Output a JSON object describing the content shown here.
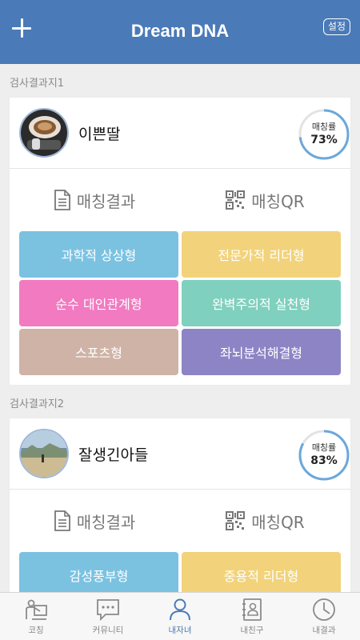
{
  "header": {
    "title": "Dream DNA",
    "settings_label": "설정"
  },
  "results": [
    {
      "section_label": "검사결과지1",
      "name": "이쁜딸",
      "rate_label": "매칭률",
      "rate_value": "73%",
      "rate_fraction": 0.73,
      "actions": {
        "result_label": "매칭결과",
        "qr_label": "매칭QR"
      },
      "tags": [
        {
          "label": "과학적 상상형",
          "color": "#7bc2e1"
        },
        {
          "label": "전문가적 리더형",
          "color": "#f2d37b"
        },
        {
          "label": "순수 대인관계형",
          "color": "#f17ac0"
        },
        {
          "label": "완벽주의적 실천형",
          "color": "#7fd0be"
        },
        {
          "label": "스포츠형",
          "color": "#cfb3a6"
        },
        {
          "label": "좌뇌분석해결형",
          "color": "#8c84c5"
        }
      ]
    },
    {
      "section_label": "검사결과지2",
      "name": "잘생긴아들",
      "rate_label": "매칭률",
      "rate_value": "83%",
      "rate_fraction": 0.83,
      "actions": {
        "result_label": "매칭결과",
        "qr_label": "매칭QR"
      },
      "tags": [
        {
          "label": "감성풍부형",
          "color": "#7bc2e1"
        },
        {
          "label": "중용적 리더형",
          "color": "#f2d37b"
        }
      ]
    }
  ],
  "tabbar": {
    "items": [
      {
        "label": "코칭",
        "icon": "coaching-icon",
        "active": false
      },
      {
        "label": "커뮤니티",
        "icon": "community-icon",
        "active": false
      },
      {
        "label": "내자녀",
        "icon": "person-icon",
        "active": true
      },
      {
        "label": "내친구",
        "icon": "contacts-icon",
        "active": false
      },
      {
        "label": "내결과",
        "icon": "clock-icon",
        "active": false
      }
    ]
  },
  "colors": {
    "header": "#4a7ab8",
    "ring": "#6aa8dc",
    "active_tab": "#4a7ab8"
  }
}
